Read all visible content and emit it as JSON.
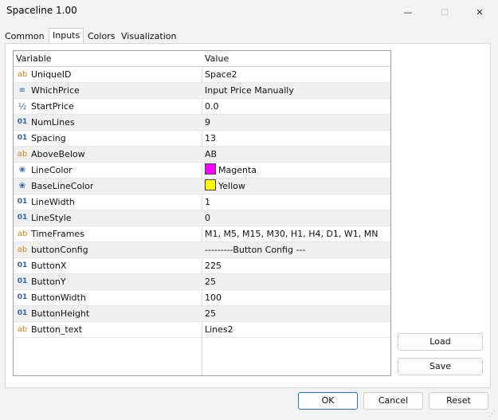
{
  "window": {
    "title": "Spaceline 1.00",
    "minimize_icon": "—",
    "maximize_icon": "☐",
    "close_icon": "✕"
  },
  "tabs": [
    "Common",
    "Inputs",
    "Colors",
    "Visualization"
  ],
  "active_tab": "Inputs",
  "grid": {
    "headers": {
      "variable": "Variable",
      "value": "Value"
    },
    "rows": [
      {
        "icon": "ab",
        "name": "UniqueID",
        "value": "Space2"
      },
      {
        "icon": "≡",
        "name": "WhichPrice",
        "value": "Input Price Manually"
      },
      {
        "icon": "½",
        "name": "StartPrice",
        "value": "0.0"
      },
      {
        "icon": "01",
        "name": "NumLines",
        "value": "9"
      },
      {
        "icon": "01",
        "name": "Spacing",
        "value": "13"
      },
      {
        "icon": "ab",
        "name": "AboveBelow",
        "value": "AB"
      },
      {
        "icon": "❀",
        "name": "LineColor",
        "value": "Magenta",
        "swatch": "#ff00ff"
      },
      {
        "icon": "❀",
        "name": "BaseLineColor",
        "value": "Yellow",
        "swatch": "#ffff00"
      },
      {
        "icon": "01",
        "name": "LineWidth",
        "value": "1"
      },
      {
        "icon": "01",
        "name": "LineStyle",
        "value": "0"
      },
      {
        "icon": "ab",
        "name": "TimeFrames",
        "value": "M1, M5, M15, M30, H1, H4, D1, W1, MN"
      },
      {
        "icon": "ab",
        "name": "buttonConfig",
        "value": "---------Button Config ---"
      },
      {
        "icon": "01",
        "name": "ButtonX",
        "value": "225"
      },
      {
        "icon": "01",
        "name": "ButtonY",
        "value": "25"
      },
      {
        "icon": "01",
        "name": "ButtonWidth",
        "value": "100"
      },
      {
        "icon": "01",
        "name": "ButtonHeight",
        "value": "25"
      },
      {
        "icon": "ab",
        "name": "Button_text",
        "value": "Lines2"
      }
    ]
  },
  "side_buttons": {
    "load": "Load",
    "save": "Save"
  },
  "footer_buttons": {
    "ok": "OK",
    "cancel": "Cancel",
    "reset": "Reset"
  }
}
